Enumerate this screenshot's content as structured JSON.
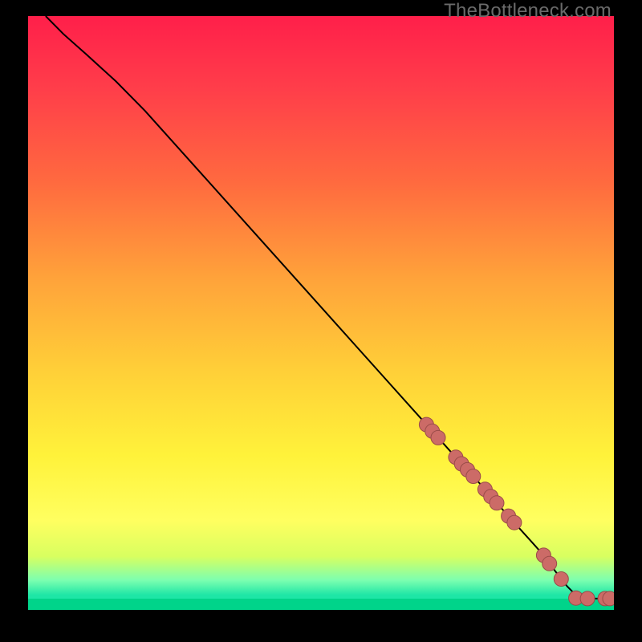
{
  "watermark": "TheBottleneck.com",
  "colors": {
    "marker_fill": "#cc6b67",
    "marker_stroke": "#9a4c49",
    "curve": "#000000"
  },
  "chart_data": {
    "type": "line",
    "title": "",
    "xlabel": "",
    "ylabel": "",
    "xlim": [
      0,
      100
    ],
    "ylim": [
      0,
      100
    ],
    "grid": false,
    "legend": false,
    "series": [
      {
        "name": "curve",
        "x": [
          3,
          6,
          10,
          15,
          20,
          30,
          40,
          50,
          60,
          68,
          70,
          73,
          76,
          78,
          80,
          82,
          84,
          86,
          88,
          90,
          92,
          94,
          97,
          99
        ],
        "y": [
          100,
          97,
          93.5,
          89,
          84,
          73,
          62,
          51,
          40,
          31.2,
          29,
          25.7,
          22.5,
          20.3,
          18,
          15.8,
          13.6,
          11.4,
          9.2,
          6.5,
          4,
          2,
          1.9,
          1.9
        ]
      }
    ],
    "markers": [
      {
        "x": 68,
        "y": 31.2
      },
      {
        "x": 69,
        "y": 30.1
      },
      {
        "x": 70,
        "y": 29.0
      },
      {
        "x": 73,
        "y": 25.7
      },
      {
        "x": 74,
        "y": 24.6
      },
      {
        "x": 75,
        "y": 23.6
      },
      {
        "x": 76,
        "y": 22.5
      },
      {
        "x": 78,
        "y": 20.3
      },
      {
        "x": 79,
        "y": 19.1
      },
      {
        "x": 80,
        "y": 18.0
      },
      {
        "x": 82,
        "y": 15.8
      },
      {
        "x": 83,
        "y": 14.7
      },
      {
        "x": 88,
        "y": 9.2
      },
      {
        "x": 89,
        "y": 7.8
      },
      {
        "x": 91,
        "y": 5.2
      },
      {
        "x": 93.5,
        "y": 2.0
      },
      {
        "x": 95.5,
        "y": 1.9
      },
      {
        "x": 98.5,
        "y": 1.9
      },
      {
        "x": 99.3,
        "y": 1.9
      }
    ]
  }
}
